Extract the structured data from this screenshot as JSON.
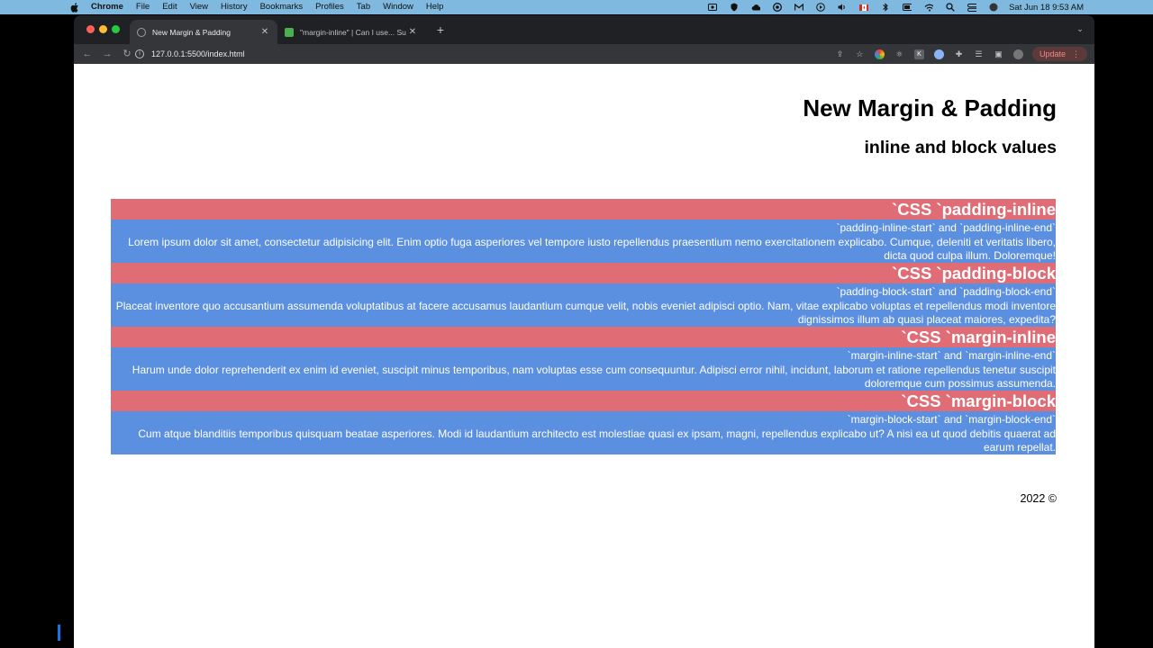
{
  "menubar": {
    "app_name": "Chrome",
    "items": [
      "File",
      "Edit",
      "View",
      "History",
      "Bookmarks",
      "Profiles",
      "Tab",
      "Window",
      "Help"
    ],
    "clock": "Sat Jun 18  9:53 AM"
  },
  "browser": {
    "tabs": [
      {
        "title": "New Margin & Padding",
        "active": true
      },
      {
        "title": "\"margin-inline\" | Can I use... Su",
        "active": false
      }
    ],
    "url": "127.0.0.1:5500/index.html",
    "update_label": "Update"
  },
  "page": {
    "title": "New Margin & Padding",
    "subtitle": "inline and block values",
    "sections": [
      {
        "heading": "`CSS `padding-inline",
        "sub": "`padding-inline-start` and `padding-inline-end`",
        "text": "Lorem ipsum dolor sit amet, consectetur adipisicing elit. Enim optio fuga asperiores vel tempore iusto repellendus praesentium nemo exercitationem explicabo. Cumque, deleniti et veritatis libero, dicta quod culpa illum. Doloremque!"
      },
      {
        "heading": "`CSS `padding-block",
        "sub": "`padding-block-start` and `padding-block-end`",
        "text": "Placeat inventore quo accusantium assumenda voluptatibus at facere accusamus laudantium cumque velit, nobis eveniet adipisci optio. Nam, vitae explicabo voluptas et repellendus modi inventore dignissimos illum ab quasi placeat maiores, expedita?"
      },
      {
        "heading": "`CSS `margin-inline",
        "sub": "`margin-inline-start` and `margin-inline-end`",
        "text": "Harum unde dolor reprehenderit ex enim id eveniet, suscipit minus temporibus, nam voluptas esse cum consequuntur. Adipisci error nihil, incidunt, laborum et ratione repellendus tenetur suscipit doloremque cum possimus assumenda."
      },
      {
        "heading": "`CSS `margin-block",
        "sub": "`margin-block-start` and `margin-block-end`",
        "text": "Cum atque blanditiis temporibus quisquam beatae asperiores. Modi id laudantium architecto est molestiae quasi ex ipsam, magni, repellendus explicabo ut? A nisi ea ut quod debitis quaerat ad earum repellat."
      }
    ],
    "footer": "2022 ©"
  },
  "colors": {
    "heading_bg": "#e06c75",
    "body_bg": "#5b8fdf",
    "menubar_bg": "#7fb9e0"
  }
}
